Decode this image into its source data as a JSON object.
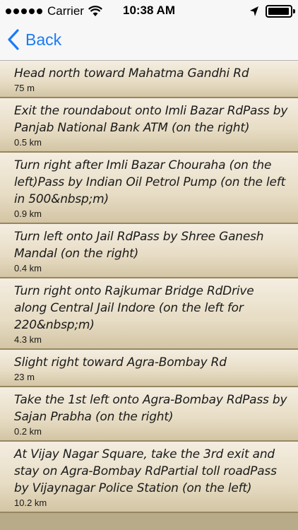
{
  "status_bar": {
    "carrier": "Carrier",
    "time": "10:38 AM",
    "battery_level": 0.95,
    "icons": [
      "signal-icon",
      "wifi-icon",
      "location-arrow-icon",
      "battery-icon"
    ]
  },
  "nav": {
    "back_label": "Back",
    "accent_color": "#1a7bf7"
  },
  "steps": [
    {
      "instruction": "Head north toward Mahatma Gandhi Rd",
      "distance": "75 m"
    },
    {
      "instruction": "Exit the roundabout onto Imli Bazar RdPass by Panjab National Bank ATM (on the right)",
      "distance": "0.5 km"
    },
    {
      "instruction": "Turn right after Imli Bazar Chouraha (on the left)Pass by Indian Oil Petrol Pump (on the left in 500&nbsp;m)",
      "distance": "0.9 km"
    },
    {
      "instruction": "Turn left onto Jail RdPass by Shree Ganesh Mandal (on the right)",
      "distance": "0.4 km"
    },
    {
      "instruction": "Turn right onto Rajkumar Bridge RdDrive along Central Jail Indore (on the left for 220&nbsp;m)",
      "distance": "4.3 km"
    },
    {
      "instruction": "Slight right toward Agra-Bombay Rd",
      "distance": "23 m"
    },
    {
      "instruction": "Take the 1st left onto Agra-Bombay RdPass by Sajan Prabha (on the right)",
      "distance": "0.2 km"
    },
    {
      "instruction": "At Vijay Nagar Square, take the 3rd exit and stay on Agra-Bombay RdPartial toll roadPass by Vijaynagar Police Station (on the left)",
      "distance": "10.2 km"
    }
  ]
}
